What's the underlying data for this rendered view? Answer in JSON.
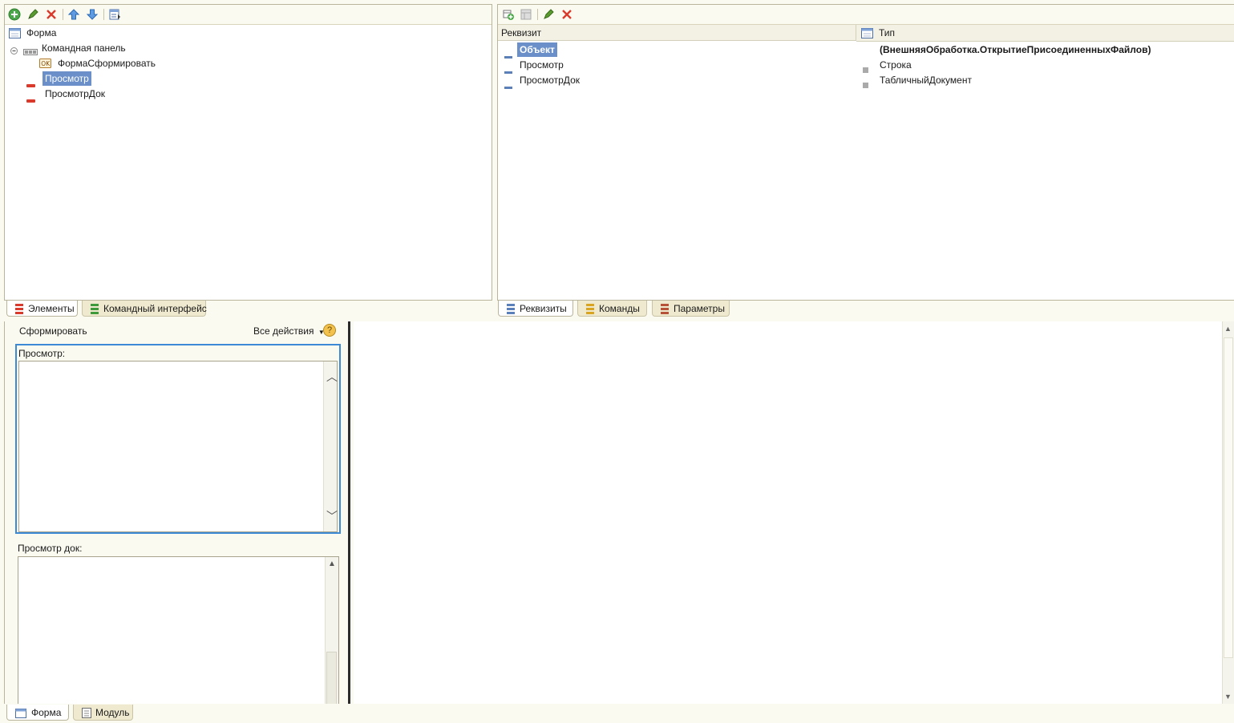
{
  "left_tree": {
    "items": [
      {
        "label": "Форма"
      },
      {
        "label": "Командная панель"
      },
      {
        "label": "ФормаСформировать"
      },
      {
        "label": "Просмотр"
      },
      {
        "label": "ПросмотрДок"
      }
    ]
  },
  "left_tabs": [
    {
      "label": "Элементы"
    },
    {
      "label": "Командный интерфейс"
    }
  ],
  "right_table": {
    "col_attr": "Реквизит",
    "col_type": "Тип",
    "rows": [
      {
        "name": "Объект",
        "type": "(ВнешняяОбработка.ОткрытиеПрисоединенныхФайлов)"
      },
      {
        "name": "Просмотр",
        "type": "Строка"
      },
      {
        "name": "ПросмотрДок",
        "type": "ТабличныйДокумент"
      }
    ]
  },
  "right_tabs": [
    {
      "label": "Реквизиты"
    },
    {
      "label": "Команды"
    },
    {
      "label": "Параметры"
    }
  ],
  "preview": {
    "command_button": "Сформировать",
    "all_actions": "Все действия",
    "help": "?",
    "field1_label": "Просмотр:",
    "field2_label": "Просмотр док:"
  },
  "bottom_tabs": [
    {
      "label": "Форма"
    },
    {
      "label": "Модуль"
    }
  ],
  "colors": {
    "selection": "#6b90c9",
    "focus_border": "#3c8ad6",
    "delete_red": "#d93a2b",
    "add_green": "#3c9a3a"
  }
}
